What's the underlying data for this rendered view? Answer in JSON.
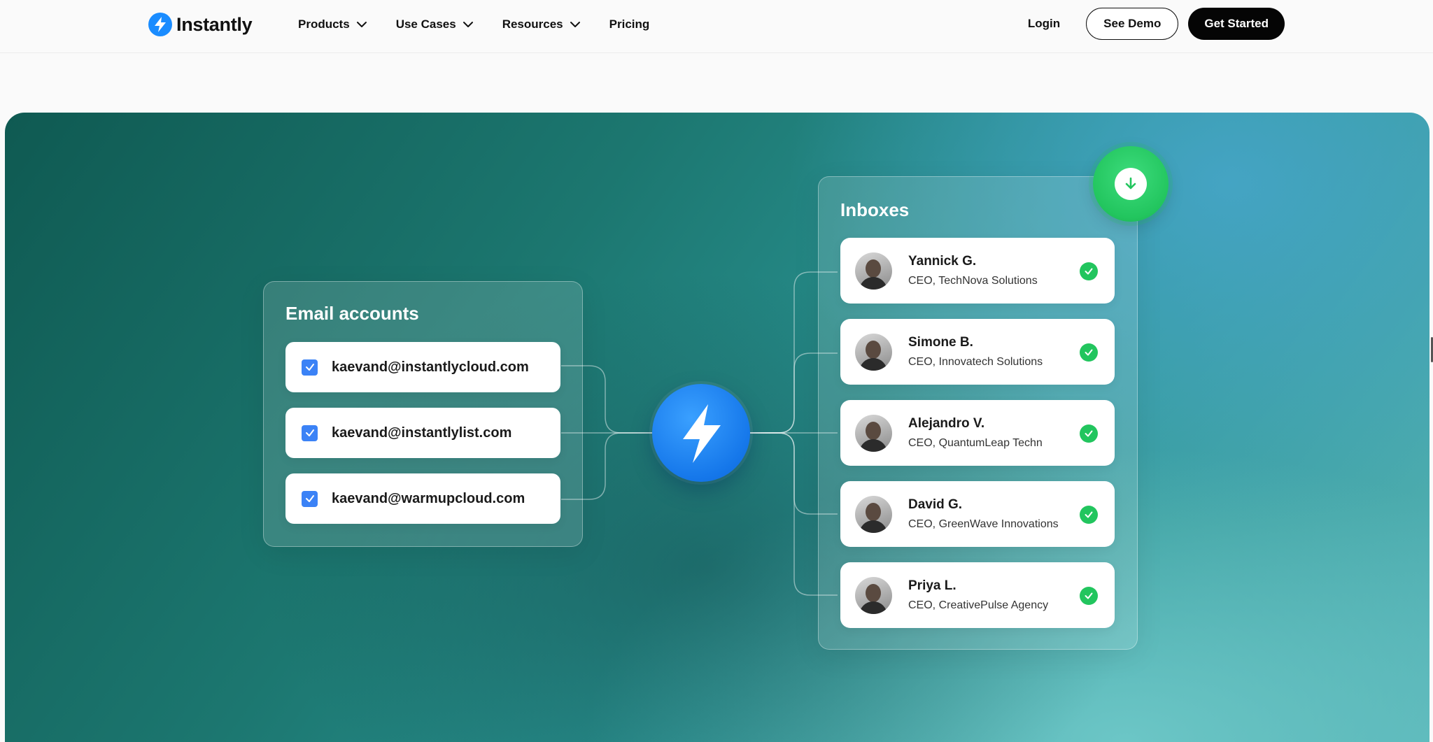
{
  "nav": {
    "brand": "Instantly",
    "menu": [
      {
        "label": "Products",
        "has_dropdown": true
      },
      {
        "label": "Use Cases",
        "has_dropdown": true
      },
      {
        "label": "Resources",
        "has_dropdown": true
      },
      {
        "label": "Pricing",
        "has_dropdown": false
      }
    ],
    "login": "Login",
    "see_demo": "See Demo",
    "get_started": "Get Started"
  },
  "hero": {
    "email_card": {
      "title": "Email accounts",
      "accounts": [
        "kaevand@instantlycloud.com",
        "kaevand@instantlylist.com",
        "kaevand@warmupcloud.com"
      ]
    },
    "inbox_card": {
      "title": "Inboxes",
      "people": [
        {
          "name": "Yannick G.",
          "role": "CEO, TechNova Solutions"
        },
        {
          "name": "Simone B.",
          "role": "CEO, Innovatech Solutions"
        },
        {
          "name": "Alejandro V.",
          "role": "CEO, QuantumLeap Techn"
        },
        {
          "name": "David G.",
          "role": "CEO, GreenWave Innovations"
        },
        {
          "name": "Priya L.",
          "role": "CEO, CreativePulse Agency"
        }
      ]
    }
  },
  "colors": {
    "brand_blue": "#1a8cff",
    "check_blue": "#3b82f6",
    "success_green": "#22c55e",
    "hero_teal": "#1c7770"
  },
  "icons": {
    "logo": "lightning-bolt-icon",
    "center": "lightning-bolt-icon",
    "download": "arrow-down-icon",
    "check": "check-icon",
    "dropdown": "chevron-down-icon"
  }
}
